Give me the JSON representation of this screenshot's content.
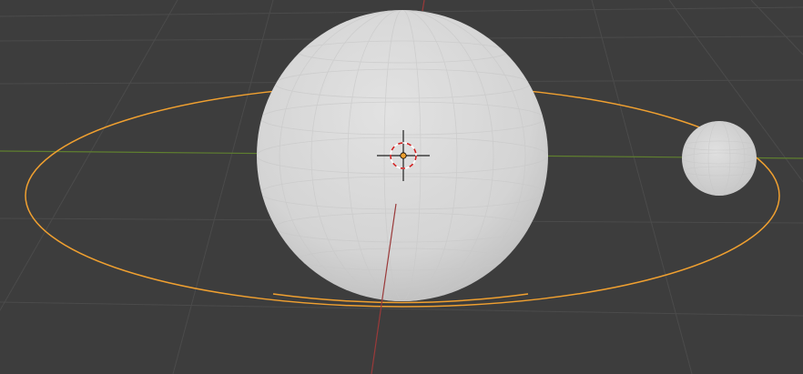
{
  "viewport": {
    "background_color": "#3d3d3d",
    "grid_color": "#4a4a4a",
    "x_axis_color": "#9a3a3a",
    "y_axis_color": "#5f7f2f",
    "selection_outline_color": "#f0a030",
    "sphere_color": "#d6d6d6"
  },
  "objects": [
    {
      "name_semantic": "large-sphere",
      "type": "uv-sphere",
      "selected": false
    },
    {
      "name_semantic": "small-sphere",
      "type": "uv-sphere",
      "selected": false
    },
    {
      "name_semantic": "orbit-circle",
      "type": "circle",
      "selected": true
    }
  ],
  "cursor": {
    "name_semantic": "3d-cursor",
    "icon": "crosshair-icon"
  },
  "origin": {
    "name_semantic": "object-origin",
    "color": "#f0a030"
  }
}
